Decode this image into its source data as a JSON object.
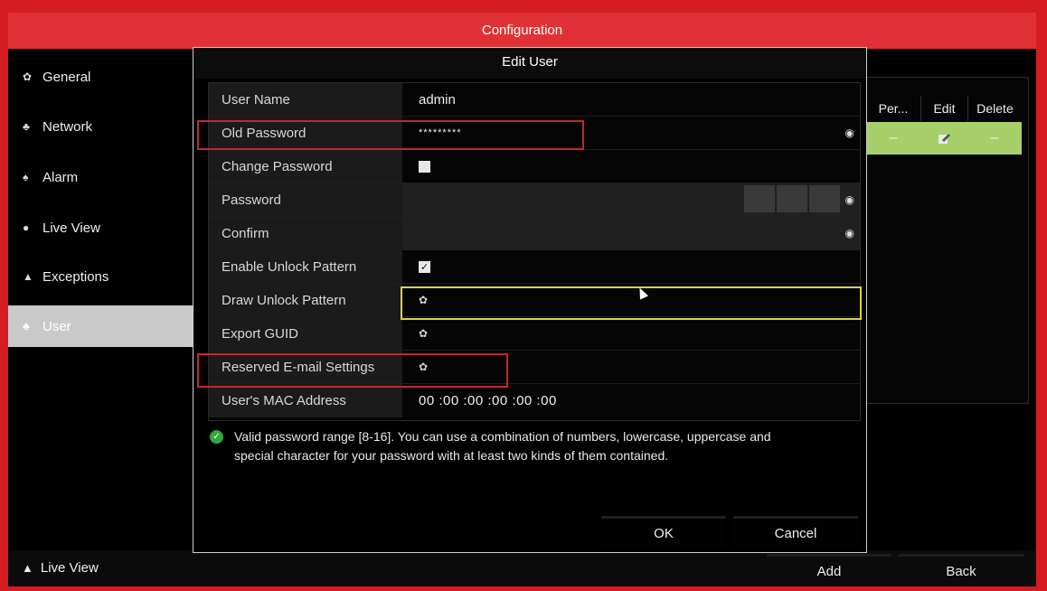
{
  "window": {
    "title": "Configuration"
  },
  "sidebar": {
    "items": [
      {
        "label": "General",
        "icon": "gear-icon",
        "glyph": "✿"
      },
      {
        "label": "Network",
        "icon": "network-icon",
        "glyph": "♣"
      },
      {
        "label": "Alarm",
        "icon": "alarm-icon",
        "glyph": "♠"
      },
      {
        "label": "Live View",
        "icon": "eye-icon",
        "glyph": "●"
      },
      {
        "label": "Exceptions",
        "icon": "warning-icon",
        "glyph": "▲"
      },
      {
        "label": "User",
        "icon": "user-icon",
        "glyph": "♣",
        "active": true
      }
    ]
  },
  "user_table": {
    "columns": [
      "Per...",
      "Edit",
      "Delete"
    ],
    "row": {
      "permission": "–",
      "edit_icon": "edit-icon",
      "delete": "–"
    }
  },
  "bottom_bar": {
    "live_view": "Live View",
    "add": "Add",
    "back": "Back"
  },
  "dialog": {
    "title": "Edit User",
    "fields": {
      "user_name": {
        "label": "User Name",
        "value": "admin"
      },
      "old_password": {
        "label": "Old Password",
        "value": "*********"
      },
      "change_password": {
        "label": "Change Password",
        "checked": false
      },
      "password": {
        "label": "Password",
        "value": ""
      },
      "confirm": {
        "label": "Confirm",
        "value": ""
      },
      "enable_unlock_pattern": {
        "label": "Enable Unlock Pattern",
        "checked": true
      },
      "draw_unlock_pattern": {
        "label": "Draw Unlock Pattern"
      },
      "export_guid": {
        "label": "Export GUID"
      },
      "reserved_email": {
        "label": "Reserved E-mail Settings"
      },
      "mac_address": {
        "label": "User's MAC Address",
        "value": "00 :00 :00 :00 :00 :00"
      }
    },
    "hint": "Valid password range [8-16]. You can use a combination of numbers, lowercase, uppercase and special character for your password with at least two kinds of them contained.",
    "ok": "OK",
    "cancel": "Cancel"
  },
  "colors": {
    "frame_red": "#d51c22",
    "highlight_red": "#c3272d",
    "highlight_yellow": "#d8d33c",
    "row_selected": "#a8d06a",
    "success_green": "#2fa83e"
  }
}
